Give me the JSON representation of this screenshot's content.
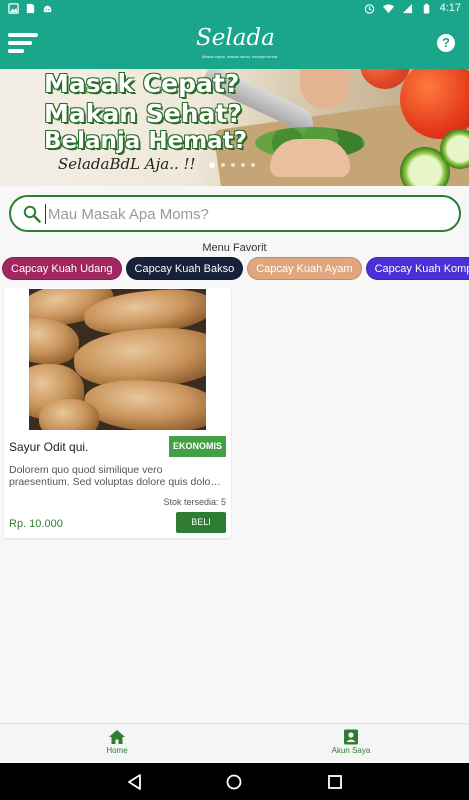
{
  "status_bar": {
    "time": "4:17"
  },
  "app": {
    "logo_text": "Selada",
    "logo_tagline": "Masak cepat, makan sehat, belanja hemat",
    "help_label": "?"
  },
  "banner": {
    "line1": "Masak Cepat?",
    "line2": "Makan Sehat?",
    "line3": "Belanja Hemat?",
    "signature": "SeladaBdL Aja.. !!",
    "slide_count": 5,
    "active_slide": 1
  },
  "search": {
    "placeholder": "Mau Masak Apa Moms?",
    "value": ""
  },
  "favorites": {
    "title": "Menu Favorit",
    "chips": [
      {
        "label": "Capcay Kuah Udang",
        "color": "#a0275f"
      },
      {
        "label": "Capcay Kuah Bakso",
        "color": "#16213a"
      },
      {
        "label": "Capcay Kuah Ayam",
        "color": "#e0a77e"
      },
      {
        "label": "Capcay Kuah Komplit",
        "color": "#4a31d6"
      }
    ]
  },
  "products": [
    {
      "name": "Sayur Odit qui.",
      "badge": "EKONOMIS",
      "description": "Dolorem quo quod similique vero praesentium. Sed voluptas dolore quis dolo…",
      "stock": "Stok tersedia: 5",
      "price": "Rp. 10.000",
      "buy_label": "BELI"
    }
  ],
  "bottom_nav": {
    "home_label": "Home",
    "account_label": "Akun Saya"
  },
  "colors": {
    "primary": "#1aa68a",
    "accent_green": "#2e7d32",
    "badge_green": "#43a047"
  }
}
